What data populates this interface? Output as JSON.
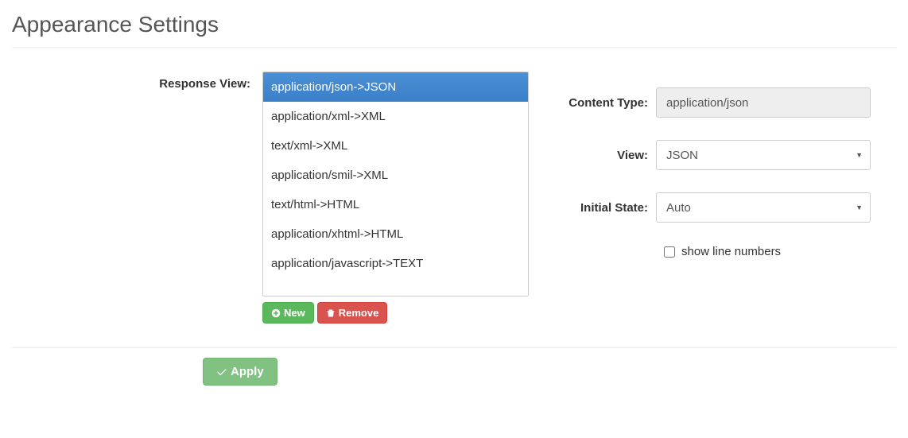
{
  "title": "Appearance Settings",
  "labels": {
    "response_view": "Response View:",
    "content_type": "Content Type:",
    "view": "View:",
    "initial_state": "Initial State:",
    "show_line_numbers": "show line numbers",
    "new_btn": "New",
    "remove_btn": "Remove",
    "apply_btn": "Apply"
  },
  "response_views": [
    {
      "label": "application/json->JSON",
      "selected": true
    },
    {
      "label": "application/xml->XML",
      "selected": false
    },
    {
      "label": "text/xml->XML",
      "selected": false
    },
    {
      "label": "application/smil->XML",
      "selected": false
    },
    {
      "label": "text/html->HTML",
      "selected": false
    },
    {
      "label": "application/xhtml->HTML",
      "selected": false
    },
    {
      "label": "application/javascript->TEXT",
      "selected": false
    }
  ],
  "content_type_value": "application/json",
  "view_options": [
    "JSON"
  ],
  "view_selected": "JSON",
  "initial_state_options": [
    "Auto"
  ],
  "initial_state_selected": "Auto",
  "show_line_numbers_checked": false
}
